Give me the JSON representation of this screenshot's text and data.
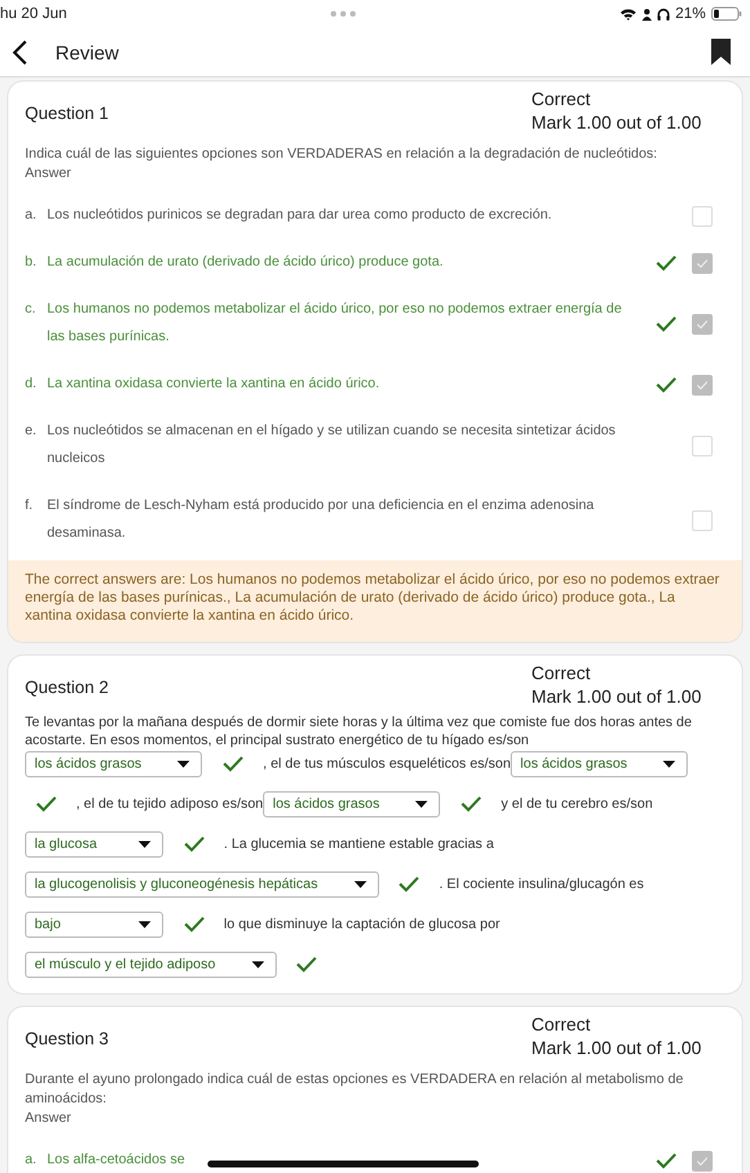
{
  "status_bar": {
    "date": "hu 20 Jun",
    "battery_text": "21%"
  },
  "header": {
    "title": "Review"
  },
  "questions": [
    {
      "title": "Question 1",
      "state": "Correct",
      "mark": "Mark 1.00 out of 1.00",
      "kind": "multi",
      "prompt": "Indica cuál de las siguientes opciones son VERDADERAS en relación a la degradación de nucleótidos:",
      "answer_label": "Answer",
      "options": [
        {
          "letter": "a.",
          "text": "Los nucleótidos purinicos se degradan para dar urea como producto de excreción.",
          "correct": false,
          "checked": false
        },
        {
          "letter": "b.",
          "text": "La acumulación de urato (derivado de ácido úrico) produce gota.",
          "correct": true,
          "checked": true
        },
        {
          "letter": "c.",
          "text": "Los humanos no podemos metabolizar el ácido úrico, por eso no podemos extraer energía de las bases purínicas.",
          "correct": true,
          "checked": true
        },
        {
          "letter": "d.",
          "text": "La xantina oxidasa convierte la xantina en ácido úrico.",
          "correct": true,
          "checked": true
        },
        {
          "letter": "e.",
          "text": "Los nucleótidos se almacenan en el hígado y se utilizan cuando se necesita sintetizar ácidos nucleicos",
          "correct": false,
          "checked": false
        },
        {
          "letter": "f.",
          "text": "El síndrome de Lesch-Nyham está producido por una deficiencia en el enzima adenosina desaminasa.",
          "correct": false,
          "checked": false
        }
      ],
      "feedback": "The correct answers are: Los humanos no podemos metabolizar el ácido úrico, por eso no podemos extraer energía de las bases purínicas., La acumulación de urato (derivado de ácido úrico) produce gota., La xantina oxidasa convierte la xantina en ácido úrico."
    },
    {
      "title": "Question 2",
      "state": "Correct",
      "mark": "Mark 1.00 out of 1.00",
      "kind": "gaps",
      "prompt": "Te levantas por la mañana después de dormir siete horas y la última vez que comiste fue dos horas antes de acostarte. En esos momentos, el principal sustrato energético de tu hígado es/son",
      "segments": [
        {
          "kind": "select",
          "value": "los ácidos grasos",
          "correct": true
        },
        {
          "kind": "text",
          "text": ", el de tus músculos esqueléticos es/son"
        },
        {
          "kind": "select",
          "value": "los ácidos grasos",
          "correct": true
        },
        {
          "kind": "text",
          "text": ", el de tu tejido adiposo es/son"
        },
        {
          "kind": "select",
          "value": "los ácidos grasos",
          "correct": true
        },
        {
          "kind": "text",
          "text": "y el de tu cerebro es/son"
        },
        {
          "kind": "select",
          "value": "la glucosa",
          "correct": true
        },
        {
          "kind": "text",
          "text": ". La glucemia se mantiene estable gracias a"
        },
        {
          "kind": "select",
          "value": "la glucogenolisis y gluconeogénesis hepáticas",
          "correct": true
        },
        {
          "kind": "text",
          "text": ". El cociente insulina/glucagón es"
        },
        {
          "kind": "select",
          "value": "bajo",
          "correct": true
        },
        {
          "kind": "text",
          "text": "lo que disminuye la captación de glucosa por"
        },
        {
          "kind": "select",
          "value": "el músculo y el tejido adiposo",
          "correct": true
        }
      ]
    },
    {
      "title": "Question 3",
      "state": "Correct",
      "mark": "Mark 1.00 out of 1.00",
      "kind": "multi",
      "prompt": "Durante el ayuno prolongado indica cuál de estas opciones es VERDADERA en relación al metabolismo de aminoácidos:",
      "answer_label": "Answer",
      "options": [
        {
          "letter": "a.",
          "text": "Los alfa-cetoácidos se",
          "correct": true,
          "checked": true
        }
      ]
    }
  ]
}
